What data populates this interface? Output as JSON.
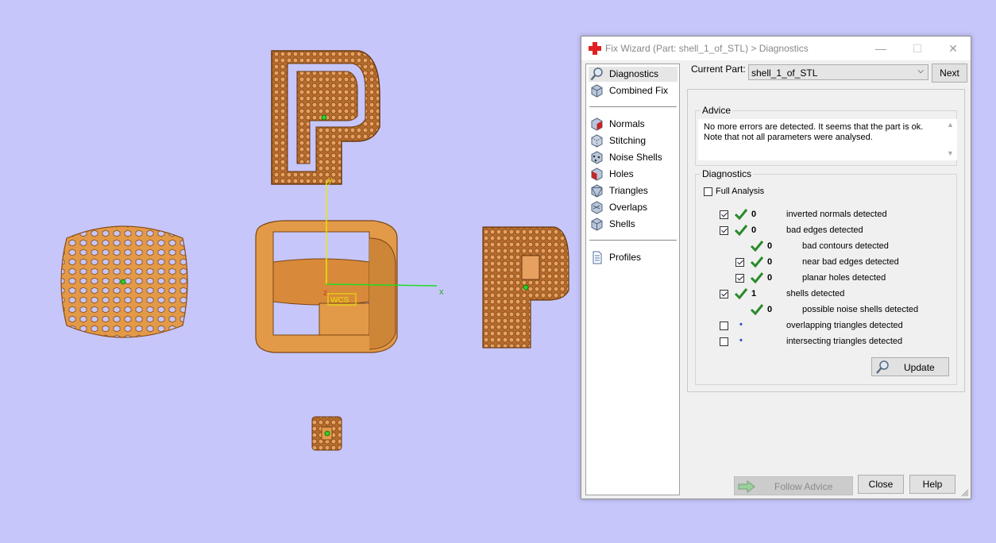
{
  "viewport": {
    "axis_x_label": "x",
    "axis_y_label": "y",
    "axis_z_label": "z",
    "wcs_label": "WCS",
    "background_color": "#c6c6fa",
    "part_color": "#e39a48"
  },
  "window": {
    "title": "Fix Wizard (Part: shell_1_of_STL) > Diagnostics",
    "title_icon": "red-cross-icon",
    "minimize": "—",
    "maximize": "☐",
    "close": "✕"
  },
  "nav": {
    "items": [
      {
        "label": "Diagnostics",
        "icon": "magnifier-icon"
      },
      {
        "label": "Combined Fix",
        "icon": "cube-icon"
      },
      {
        "label": "Normals",
        "icon": "normals-cube-icon"
      },
      {
        "label": "Stitching",
        "icon": "stitching-cube-icon"
      },
      {
        "label": "Noise Shells",
        "icon": "noise-shells-icon"
      },
      {
        "label": "Holes",
        "icon": "holes-cube-icon"
      },
      {
        "label": "Triangles",
        "icon": "triangles-cube-icon"
      },
      {
        "label": "Overlaps",
        "icon": "overlaps-cube-icon"
      },
      {
        "label": "Shells",
        "icon": "shells-cube-icon"
      },
      {
        "label": "Profiles",
        "icon": "document-icon"
      }
    ]
  },
  "current_part": {
    "label": "Current Part:",
    "value": "shell_1_of_STL",
    "next_label": "Next"
  },
  "advice": {
    "title": "Advice",
    "text": "No more errors are detected. It seems that the part is ok. Note that not all parameters were analysed."
  },
  "diagnostics": {
    "title": "Diagnostics",
    "full_analysis_label": "Full Analysis",
    "full_analysis_checked": false,
    "rows": [
      {
        "checkbox": true,
        "checked": true,
        "status": "ok",
        "count": "0",
        "label": "inverted normals detected"
      },
      {
        "checkbox": true,
        "checked": true,
        "status": "ok",
        "count": "0",
        "label": "bad edges detected"
      },
      {
        "checkbox": false,
        "checked": false,
        "status": "ok",
        "count": "0",
        "label": "bad contours detected"
      },
      {
        "checkbox": true,
        "checked": true,
        "status": "ok",
        "count": "0",
        "label": "near bad edges detected"
      },
      {
        "checkbox": true,
        "checked": true,
        "status": "ok",
        "count": "0",
        "label": "planar holes detected"
      },
      {
        "checkbox": true,
        "checked": true,
        "status": "ok",
        "count": "1",
        "label": "shells detected"
      },
      {
        "checkbox": false,
        "checked": false,
        "status": "ok",
        "count": "0",
        "label": "possible noise shells detected"
      },
      {
        "checkbox": true,
        "checked": false,
        "status": "dot",
        "count": "•",
        "label": "overlapping triangles detected"
      },
      {
        "checkbox": true,
        "checked": false,
        "status": "dot",
        "count": "•",
        "label": "intersecting triangles detected"
      }
    ],
    "update_label": "Update"
  },
  "footer": {
    "follow_advice_label": "Follow Advice",
    "close_label": "Close",
    "help_label": "Help"
  }
}
